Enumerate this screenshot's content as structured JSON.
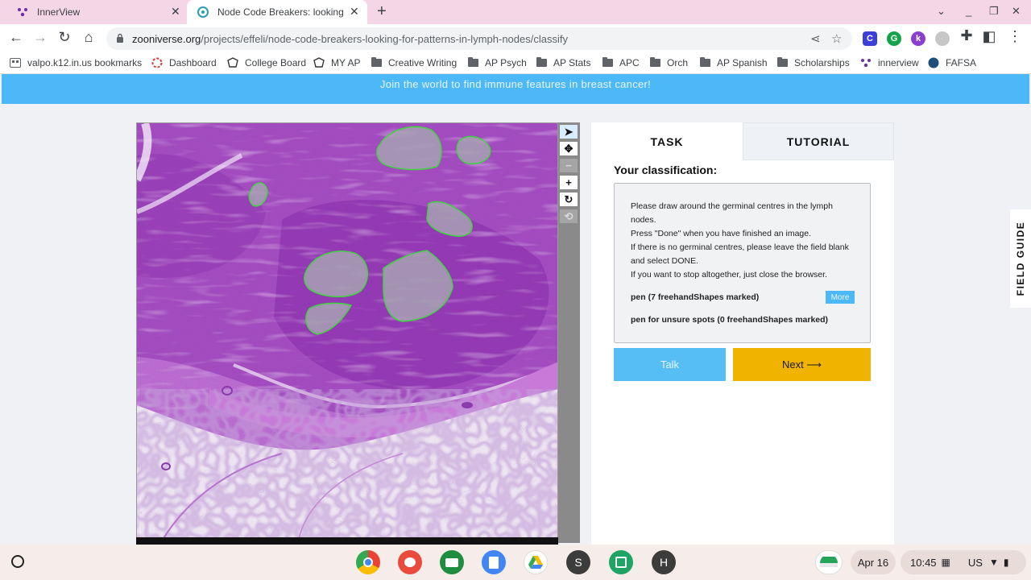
{
  "browser": {
    "tabs": [
      {
        "title": "InnerView",
        "active": false
      },
      {
        "title": "Node Code Breakers: looking for",
        "active": true
      }
    ],
    "url_host": "zooniverse.org",
    "url_path": "/projects/effeli/node-code-breakers-looking-for-patterns-in-lymph-nodes/classify",
    "extensions": [
      {
        "letter": "C",
        "color": "#3c3fd8"
      },
      {
        "letter": "G",
        "color": "#15a34a"
      },
      {
        "letter": "k",
        "color": "#8a3fd0"
      },
      {
        "letter": "",
        "color": "#c7c7c7"
      }
    ],
    "bookmarks": [
      {
        "label": "valpo.k12.in.us bookmarks",
        "icon": "bookmarks-app-icon"
      },
      {
        "label": "Dashboard",
        "icon": "dashboard-icon"
      },
      {
        "label": "College Board",
        "icon": "college-board-icon"
      },
      {
        "label": "MY AP",
        "icon": "college-board-icon"
      },
      {
        "label": "Creative Writing",
        "icon": "folder-icon"
      },
      {
        "label": "AP Psych",
        "icon": "folder-icon"
      },
      {
        "label": "AP Stats",
        "icon": "folder-icon"
      },
      {
        "label": "APC",
        "icon": "folder-icon"
      },
      {
        "label": "Orch",
        "icon": "folder-icon"
      },
      {
        "label": "AP Spanish",
        "icon": "folder-icon"
      },
      {
        "label": "Scholarships",
        "icon": "folder-icon"
      },
      {
        "label": "innerview",
        "icon": "innerview-icon"
      },
      {
        "label": "FAFSA",
        "icon": "fafsa-icon"
      }
    ]
  },
  "page": {
    "banner": "Join the world to find immune features in breast cancer!",
    "tabs": {
      "task": "TASK",
      "tutorial": "TUTORIAL"
    },
    "classification_label": "Your classification:",
    "instructions": [
      "Please draw around the germinal centres in the lymph nodes.",
      "Press \"Done\" when you have finished an image.",
      "If there is no germinal centres, please leave the field blank and select DONE.",
      "If you want to stop altogether, just close the browser."
    ],
    "tools": [
      {
        "label": "pen (7 freehandShapes marked)"
      },
      {
        "label": "pen for unsure spots (0 freehandShapes marked)"
      }
    ],
    "more_label": "More",
    "talk_label": "Talk",
    "next_label": "Next ⟶",
    "field_guide": "FIELD GUIDE"
  },
  "shelf": {
    "date": "Apr 16",
    "time": "10:45",
    "locale": "US",
    "apps": [
      {
        "name": "chrome-app-icon",
        "letter": ""
      },
      {
        "name": "paint-app-icon",
        "letter": ""
      },
      {
        "name": "classroom-app-icon",
        "letter": ""
      },
      {
        "name": "docs-app-icon",
        "letter": ""
      },
      {
        "name": "drive-app-icon",
        "letter": ""
      },
      {
        "name": "s-app-icon",
        "letter": "S"
      },
      {
        "name": "calculator-app-icon",
        "letter": ""
      },
      {
        "name": "h-app-icon",
        "letter": "H"
      }
    ]
  }
}
